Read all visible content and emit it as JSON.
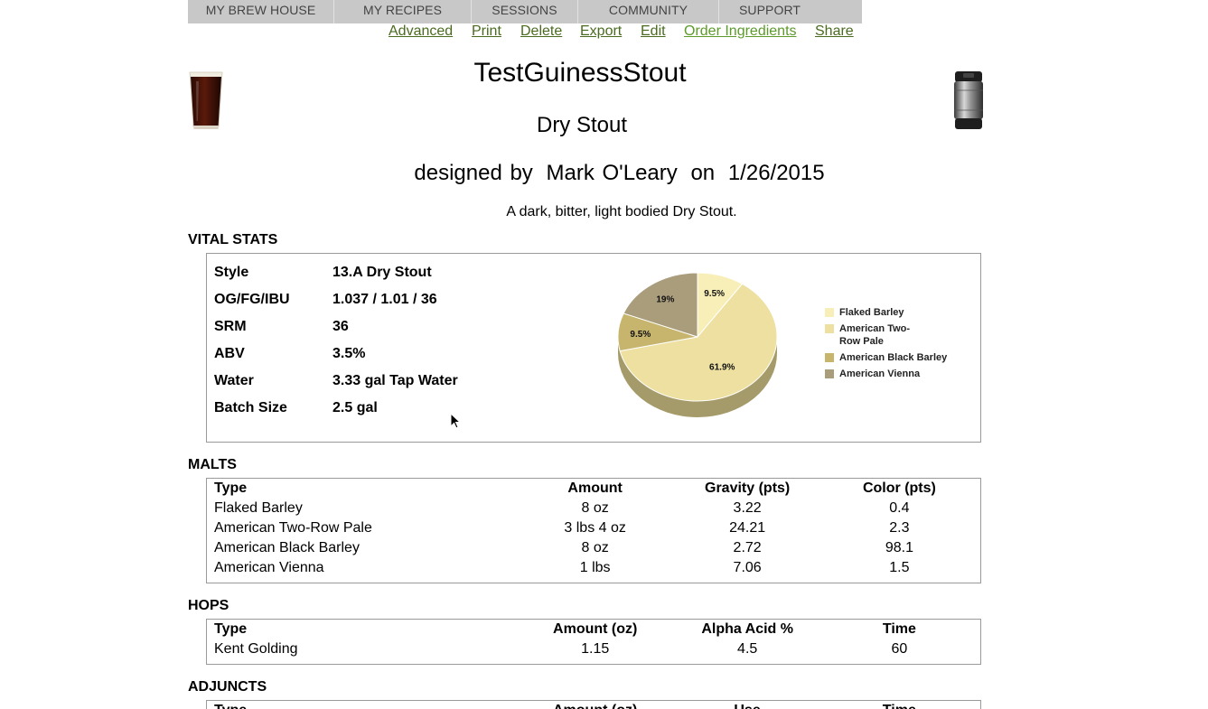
{
  "nav": {
    "items": [
      "MY BREW HOUSE",
      "MY RECIPES",
      "SESSIONS",
      "COMMUNITY",
      "SUPPORT"
    ]
  },
  "actions": {
    "advanced": "Advanced",
    "print": "Print",
    "delete": "Delete",
    "export": "Export",
    "edit": "Edit",
    "order": "Order Ingredients",
    "share": "Share"
  },
  "recipe": {
    "title": "TestGuinessStout",
    "style": "Dry Stout",
    "designed_by_prefix": "designed by",
    "author": "Mark O'Leary",
    "on": "on",
    "date": "1/26/2015",
    "description": "A dark, bitter, light bodied Dry Stout."
  },
  "sections": {
    "vital_stats": "VITAL STATS",
    "malts": "MALTS",
    "hops": "HOPS",
    "adjuncts": "ADJUNCTS"
  },
  "vital_stats": [
    {
      "label": "Style",
      "value": "13.A Dry Stout"
    },
    {
      "label": "OG/FG/IBU",
      "value": "1.037 / 1.01 / 36"
    },
    {
      "label": "SRM",
      "value": "36"
    },
    {
      "label": "ABV",
      "value": "3.5%"
    },
    {
      "label": "Water",
      "value": "3.33 gal Tap Water"
    },
    {
      "label": "Batch Size",
      "value": "2.5 gal"
    }
  ],
  "chart_data": {
    "type": "pie",
    "categories": [
      "Flaked Barley",
      "American Two-Row Pale",
      "American Black Barley",
      "American Vienna"
    ],
    "values": [
      9.5,
      61.9,
      9.5,
      19
    ],
    "labels": [
      "9.5%",
      "61.9%",
      "9.5%",
      "19%"
    ],
    "colors": [
      "#f8efb8",
      "#ede0a0",
      "#c7b46d",
      "#a99d7c"
    ],
    "side_color": "#a59b6a",
    "legend": "right"
  },
  "malts": {
    "headers": [
      "Type",
      "Amount",
      "Gravity (pts)",
      "Color (pts)"
    ],
    "rows": [
      [
        "Flaked Barley",
        "8 oz",
        "3.22",
        "0.4"
      ],
      [
        "American Two-Row Pale",
        "3 lbs 4 oz",
        "24.21",
        "2.3"
      ],
      [
        "American Black Barley",
        "8 oz",
        "2.72",
        "98.1"
      ],
      [
        "American Vienna",
        "1 lbs",
        "7.06",
        "1.5"
      ]
    ]
  },
  "hops": {
    "headers": [
      "Type",
      "Amount (oz)",
      "Alpha Acid %",
      "Time"
    ],
    "rows": [
      [
        "Kent Golding",
        "1.15",
        "4.5",
        "60"
      ]
    ]
  },
  "adjuncts": {
    "headers": [
      "Type",
      "Amount (oz)",
      "Use",
      "Time"
    ]
  },
  "icons": {
    "glass": "beer-glass-icon",
    "keg": "keg-icon",
    "cursor": "mouse-cursor-icon"
  }
}
